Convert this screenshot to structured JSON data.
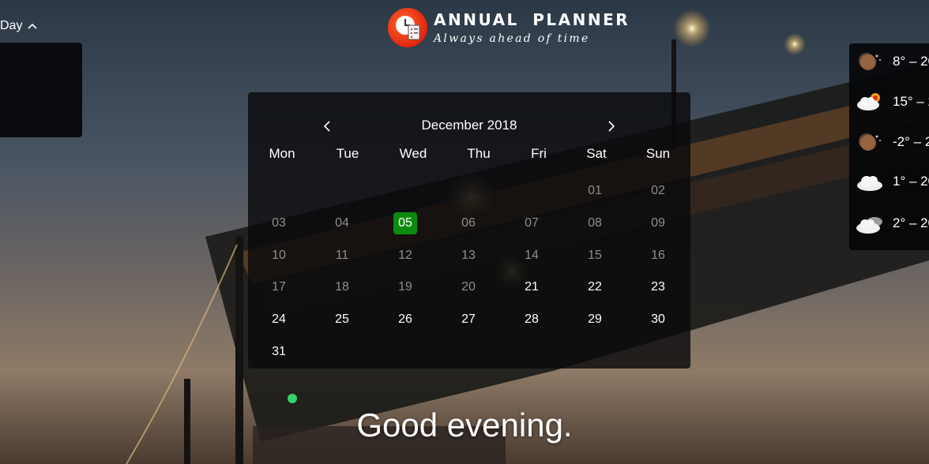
{
  "header": {
    "day_toggle": "Day",
    "logo_title": "ANNUAL PLANNER",
    "logo_tagline": "Always ahead of time"
  },
  "calendar": {
    "month_label": "December 2018",
    "weekdays": [
      "Mon",
      "Tue",
      "Wed",
      "Thu",
      "Fri",
      "Sat",
      "Sun"
    ],
    "today": "05",
    "today_color": "#0d8a10",
    "weeks": [
      [
        null,
        null,
        null,
        null,
        null,
        "01",
        "02"
      ],
      [
        "03",
        "04",
        "05",
        "06",
        "07",
        "08",
        "09"
      ],
      [
        "10",
        "11",
        "12",
        "13",
        "14",
        "15",
        "16"
      ],
      [
        "17",
        "18",
        "19",
        "20",
        "21",
        "22",
        "23"
      ],
      [
        "24",
        "25",
        "26",
        "27",
        "28",
        "29",
        "30"
      ],
      [
        "31",
        null,
        null,
        null,
        null,
        null,
        null
      ]
    ],
    "muted_days": [
      "01",
      "02",
      "03",
      "04",
      "06",
      "07",
      "08",
      "09",
      "10",
      "11",
      "12",
      "13",
      "14",
      "15",
      "16",
      "17",
      "18",
      "19",
      "20"
    ]
  },
  "weather": [
    {
      "icon": "moon-icon",
      "temp": "8° – 20"
    },
    {
      "icon": "partly-cloudy-sun-icon",
      "temp": "15° – 2"
    },
    {
      "icon": "moon-icon",
      "temp": "-2° – 2"
    },
    {
      "icon": "cloud-icon",
      "temp": "1° – 20"
    },
    {
      "icon": "cloudy-icon",
      "temp": "2° – 20"
    }
  ],
  "greeting": "Good evening."
}
